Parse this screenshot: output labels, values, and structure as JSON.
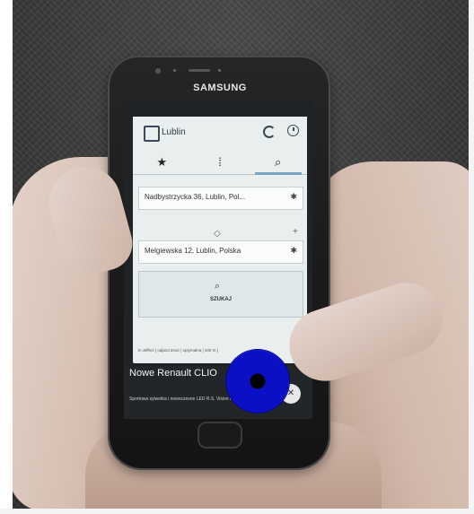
{
  "phone": {
    "brand": "SAMSUNG"
  },
  "app": {
    "title": "Lublin",
    "tabs": [
      {
        "icon": "star-icon",
        "glyph": "★"
      },
      {
        "icon": "bars-icon",
        "glyph": "⁞"
      },
      {
        "icon": "search-icon",
        "glyph": "⌕"
      }
    ],
    "from": "Nadbystrzycka 36, Lublin, Pol...",
    "to": "Melgiewska 12, Lublin, Polska",
    "search_button": "SZUKAJ",
    "footer": "E-Jeffect | odjazd teraz | optymalna | 400 m |"
  },
  "ad": {
    "title": "Nowe Renault CLIO",
    "text": "Sportowa sylwetka i nowoczesne LED R.S. Vision na szczycie"
  },
  "overlay": {
    "touch_color": "#0c10c4"
  }
}
